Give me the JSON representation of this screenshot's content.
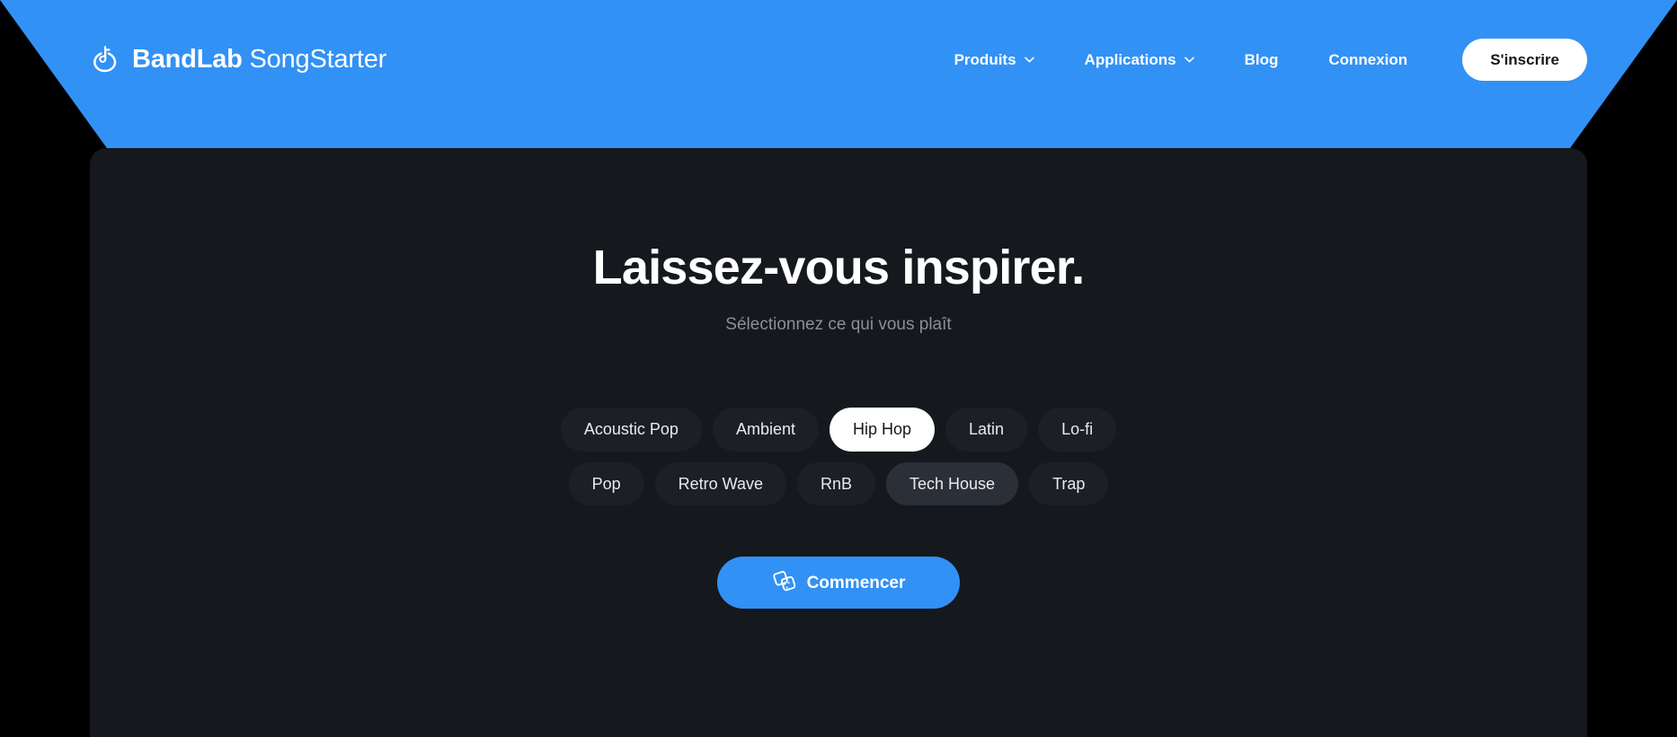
{
  "theme": {
    "brand_blue": "#3291F5",
    "panel_bg": "#15181C",
    "page_bg": "#000000",
    "chip_bg": "#1C2025",
    "chip_hover_bg": "#2B2F38",
    "chip_selected_bg": "#FFFFFF",
    "subtitle_color": "#8C9096"
  },
  "header": {
    "logo": {
      "icon": "bandlab-logo-icon",
      "brand": "BandLab",
      "product": "SongStarter"
    },
    "nav_items": [
      {
        "label": "Produits",
        "has_dropdown": true,
        "icon": "chevron-down-icon"
      },
      {
        "label": "Applications",
        "has_dropdown": true,
        "icon": "chevron-down-icon"
      },
      {
        "label": "Blog",
        "has_dropdown": false
      },
      {
        "label": "Connexion",
        "has_dropdown": false
      }
    ],
    "signup_label": "S'inscrire"
  },
  "hero": {
    "title": "Laissez-vous inspirer.",
    "subtitle": "Sélectionnez ce qui vous plaît"
  },
  "genres": [
    {
      "label": "Acoustic Pop",
      "state": "default"
    },
    {
      "label": "Ambient",
      "state": "default"
    },
    {
      "label": "Hip Hop",
      "state": "selected"
    },
    {
      "label": "Latin",
      "state": "default"
    },
    {
      "label": "Lo-fi",
      "state": "default"
    },
    {
      "label": "Pop",
      "state": "default"
    },
    {
      "label": "Retro Wave",
      "state": "default"
    },
    {
      "label": "RnB",
      "state": "default"
    },
    {
      "label": "Tech House",
      "state": "hovered"
    },
    {
      "label": "Trap",
      "state": "default"
    }
  ],
  "cta": {
    "label": "Commencer",
    "icon": "dice-icon"
  }
}
